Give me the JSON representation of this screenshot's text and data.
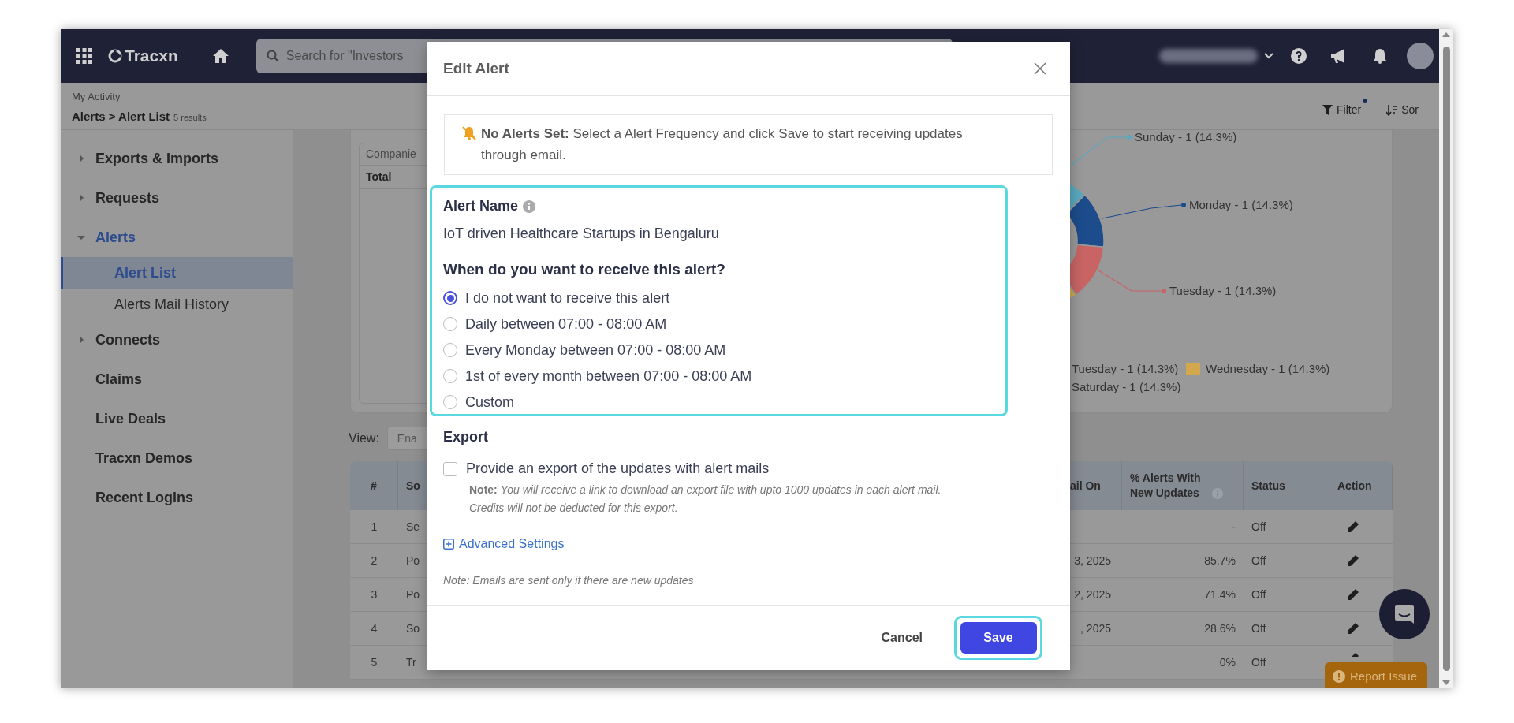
{
  "topbar": {
    "logo": "Tracxn",
    "search_placeholder": "Search for \"Investors"
  },
  "breadcrumb": {
    "section": "My Activity",
    "path": "Alerts > Alert List",
    "count": "5 results"
  },
  "toolbar": {
    "filter": "Filter",
    "sort": "Sor"
  },
  "sidebar": {
    "items": [
      {
        "label": "Exports & Imports",
        "kind": "group",
        "expanded": false,
        "selected": false
      },
      {
        "label": "Requests",
        "kind": "group",
        "expanded": false,
        "selected": false
      },
      {
        "label": "Alerts",
        "kind": "group",
        "expanded": true,
        "selected": false,
        "children": [
          {
            "label": "Alert List",
            "selected": true
          },
          {
            "label": "Alerts Mail History",
            "selected": false
          }
        ]
      },
      {
        "label": "Connects",
        "kind": "group",
        "expanded": false,
        "selected": false
      },
      {
        "label": "Claims",
        "kind": "link",
        "selected": false
      },
      {
        "label": "Live Deals",
        "kind": "link",
        "selected": false
      },
      {
        "label": "Tracxn Demos",
        "kind": "link",
        "selected": false
      },
      {
        "label": "Recent Logins",
        "kind": "link",
        "selected": false
      }
    ]
  },
  "chart_card": {
    "table_header": "Companie",
    "total_label": "Total",
    "callouts": [
      {
        "label": "Sunday - 1 (14.3%)",
        "color": "#5aa9c0"
      },
      {
        "label": "Monday - 1 (14.3%)",
        "color": "#1c4c8c"
      },
      {
        "label": "Tuesday - 1 (14.3%)",
        "color": "#c86464"
      }
    ],
    "legend": [
      {
        "label": "Tuesday - 1 (14.3%)"
      },
      {
        "label": "Wednesday - 1 (14.3%)",
        "color": "#d2a84e"
      },
      {
        "label": "Saturday - 1 (14.3%)"
      }
    ]
  },
  "view": {
    "label": "View:",
    "value": "Ena"
  },
  "table": {
    "columns": [
      "#",
      "So",
      "ail On",
      "% Alerts With New Updates",
      "Status",
      "Action"
    ],
    "rows": [
      {
        "num": "1",
        "name": "Se",
        "pct": "-",
        "status": "Off"
      },
      {
        "num": "2",
        "name": "Po",
        "date": "3, 2025",
        "pct": "85.7%",
        "status": "Off"
      },
      {
        "num": "3",
        "name": "Po",
        "date": "2, 2025",
        "pct": "71.4%",
        "status": "Off"
      },
      {
        "num": "4",
        "name": "So",
        "date": ", 2025",
        "pct": "28.6%",
        "status": "Off"
      },
      {
        "num": "5",
        "name": "Tr",
        "pct": "0%",
        "status": "Off"
      }
    ]
  },
  "report_button": "Report Issue",
  "dialog": {
    "title": "Edit Alert",
    "notice": "**No Alerts Set:** Select a Alert Frequency and click Save to start receiving updates through email.",
    "name_label": "Alert Name",
    "name_value": "IoT driven Healthcare Startups in Bengaluru",
    "question": "When do you want to receive this alert?",
    "options": [
      {
        "label": "I do not want to receive this alert",
        "selected": true
      },
      {
        "label": "Daily between 07:00 - 08:00 AM",
        "selected": false
      },
      {
        "label": "Every Monday between 07:00 - 08:00 AM",
        "selected": false
      },
      {
        "label": "1st of every month between 07:00 - 08:00 AM",
        "selected": false
      },
      {
        "label": "Custom",
        "selected": false
      }
    ],
    "export_label": "Export",
    "export_option": {
      "label": "Provide an export of the updates with alert mails",
      "checked": false
    },
    "export_note": "**Note:** *You will receive a link to download an export file with upto 1000 updates in each alert mail. Credits will not be deducted for this export.*",
    "advanced": "Advanced Settings",
    "footnote": "Note: Emails are sent only if there are new updates",
    "cancel": "Cancel",
    "save": "Save"
  }
}
